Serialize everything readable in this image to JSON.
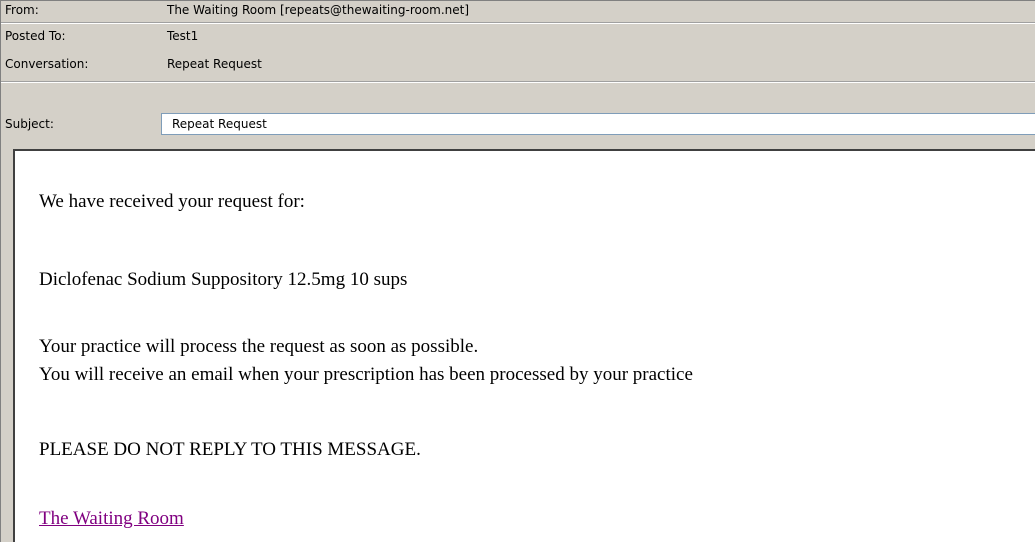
{
  "header": {
    "from": {
      "label": "From:",
      "value": "The Waiting Room [repeats@thewaiting-room.net]"
    },
    "posted_to": {
      "label": "Posted To:",
      "value": "Test1"
    },
    "conversation": {
      "label": "Conversation:",
      "value": "Repeat Request"
    },
    "subject": {
      "label": "Subject:",
      "value": "Repeat Request"
    }
  },
  "message": {
    "intro": "We have received your request for:",
    "item": "Diclofenac Sodium Suppository 12.5mg 10 sups",
    "line1": "Your practice will process the request as soon as possible.",
    "line2": "You will receive an email when your prescription has been processed by your practice",
    "notice": "PLEASE DO NOT REPLY TO THIS MESSAGE.",
    "signature_link": "The Waiting Room"
  },
  "colors": {
    "chrome": "#d4d0c8",
    "link_visited": "#800080"
  }
}
